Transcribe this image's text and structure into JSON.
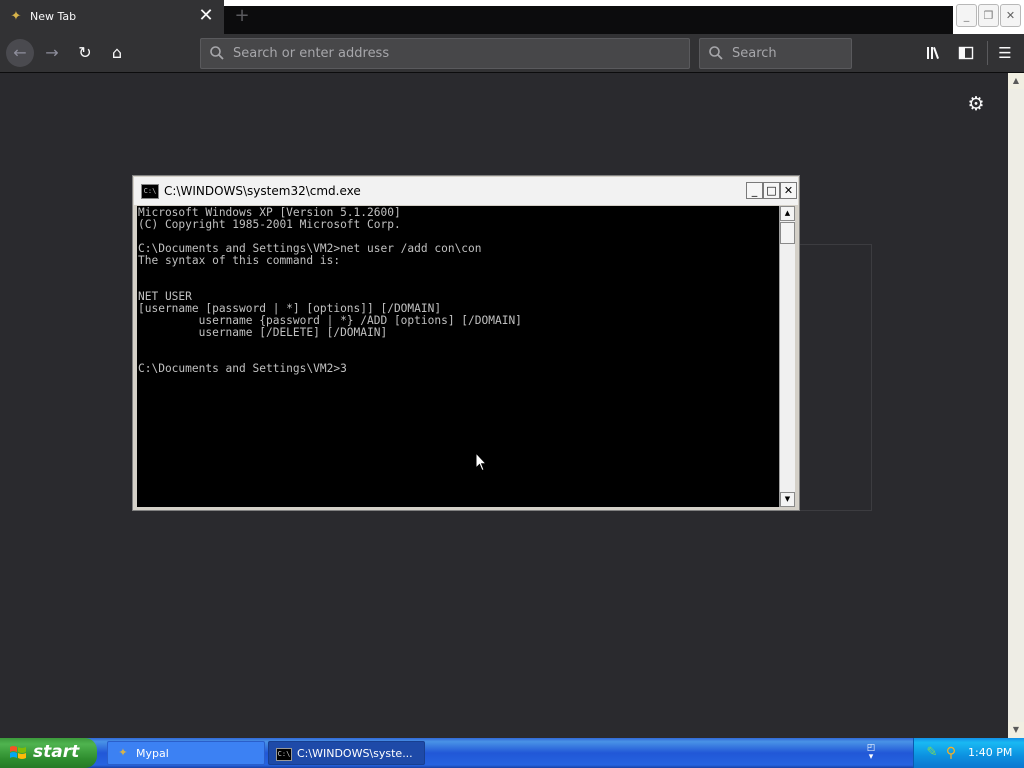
{
  "browser": {
    "tab": {
      "title": "New Tab",
      "favicon": "mypal-icon"
    },
    "address_placeholder": "Search or enter address",
    "search_placeholder": "Search"
  },
  "cmd": {
    "title": "C:\\WINDOWS\\system32\\cmd.exe",
    "lines": [
      "Microsoft Windows XP [Version 5.1.2600]",
      "(C) Copyright 1985-2001 Microsoft Corp.",
      "",
      "C:\\Documents and Settings\\VM2>net user /add con\\con",
      "The syntax of this command is:",
      "",
      "",
      "NET USER",
      "[username [password | *] [options]] [/DOMAIN]",
      "         username {password | *} /ADD [options] [/DOMAIN]",
      "         username [/DELETE] [/DOMAIN]",
      "",
      "",
      "C:\\Documents and Settings\\VM2>3"
    ]
  },
  "taskbar": {
    "start_label": "start",
    "items": [
      {
        "label": "Mypal",
        "icon": "mypal-icon"
      },
      {
        "label": "C:\\WINDOWS\\syste...",
        "icon": "cmd-icon"
      }
    ],
    "clock": "1:40 PM"
  },
  "colors": {
    "browser_bg": "#2a2a2e",
    "taskbar_blue": "#2157d7",
    "start_green": "#3c9a3c",
    "console_text": "#c0c0c0"
  }
}
